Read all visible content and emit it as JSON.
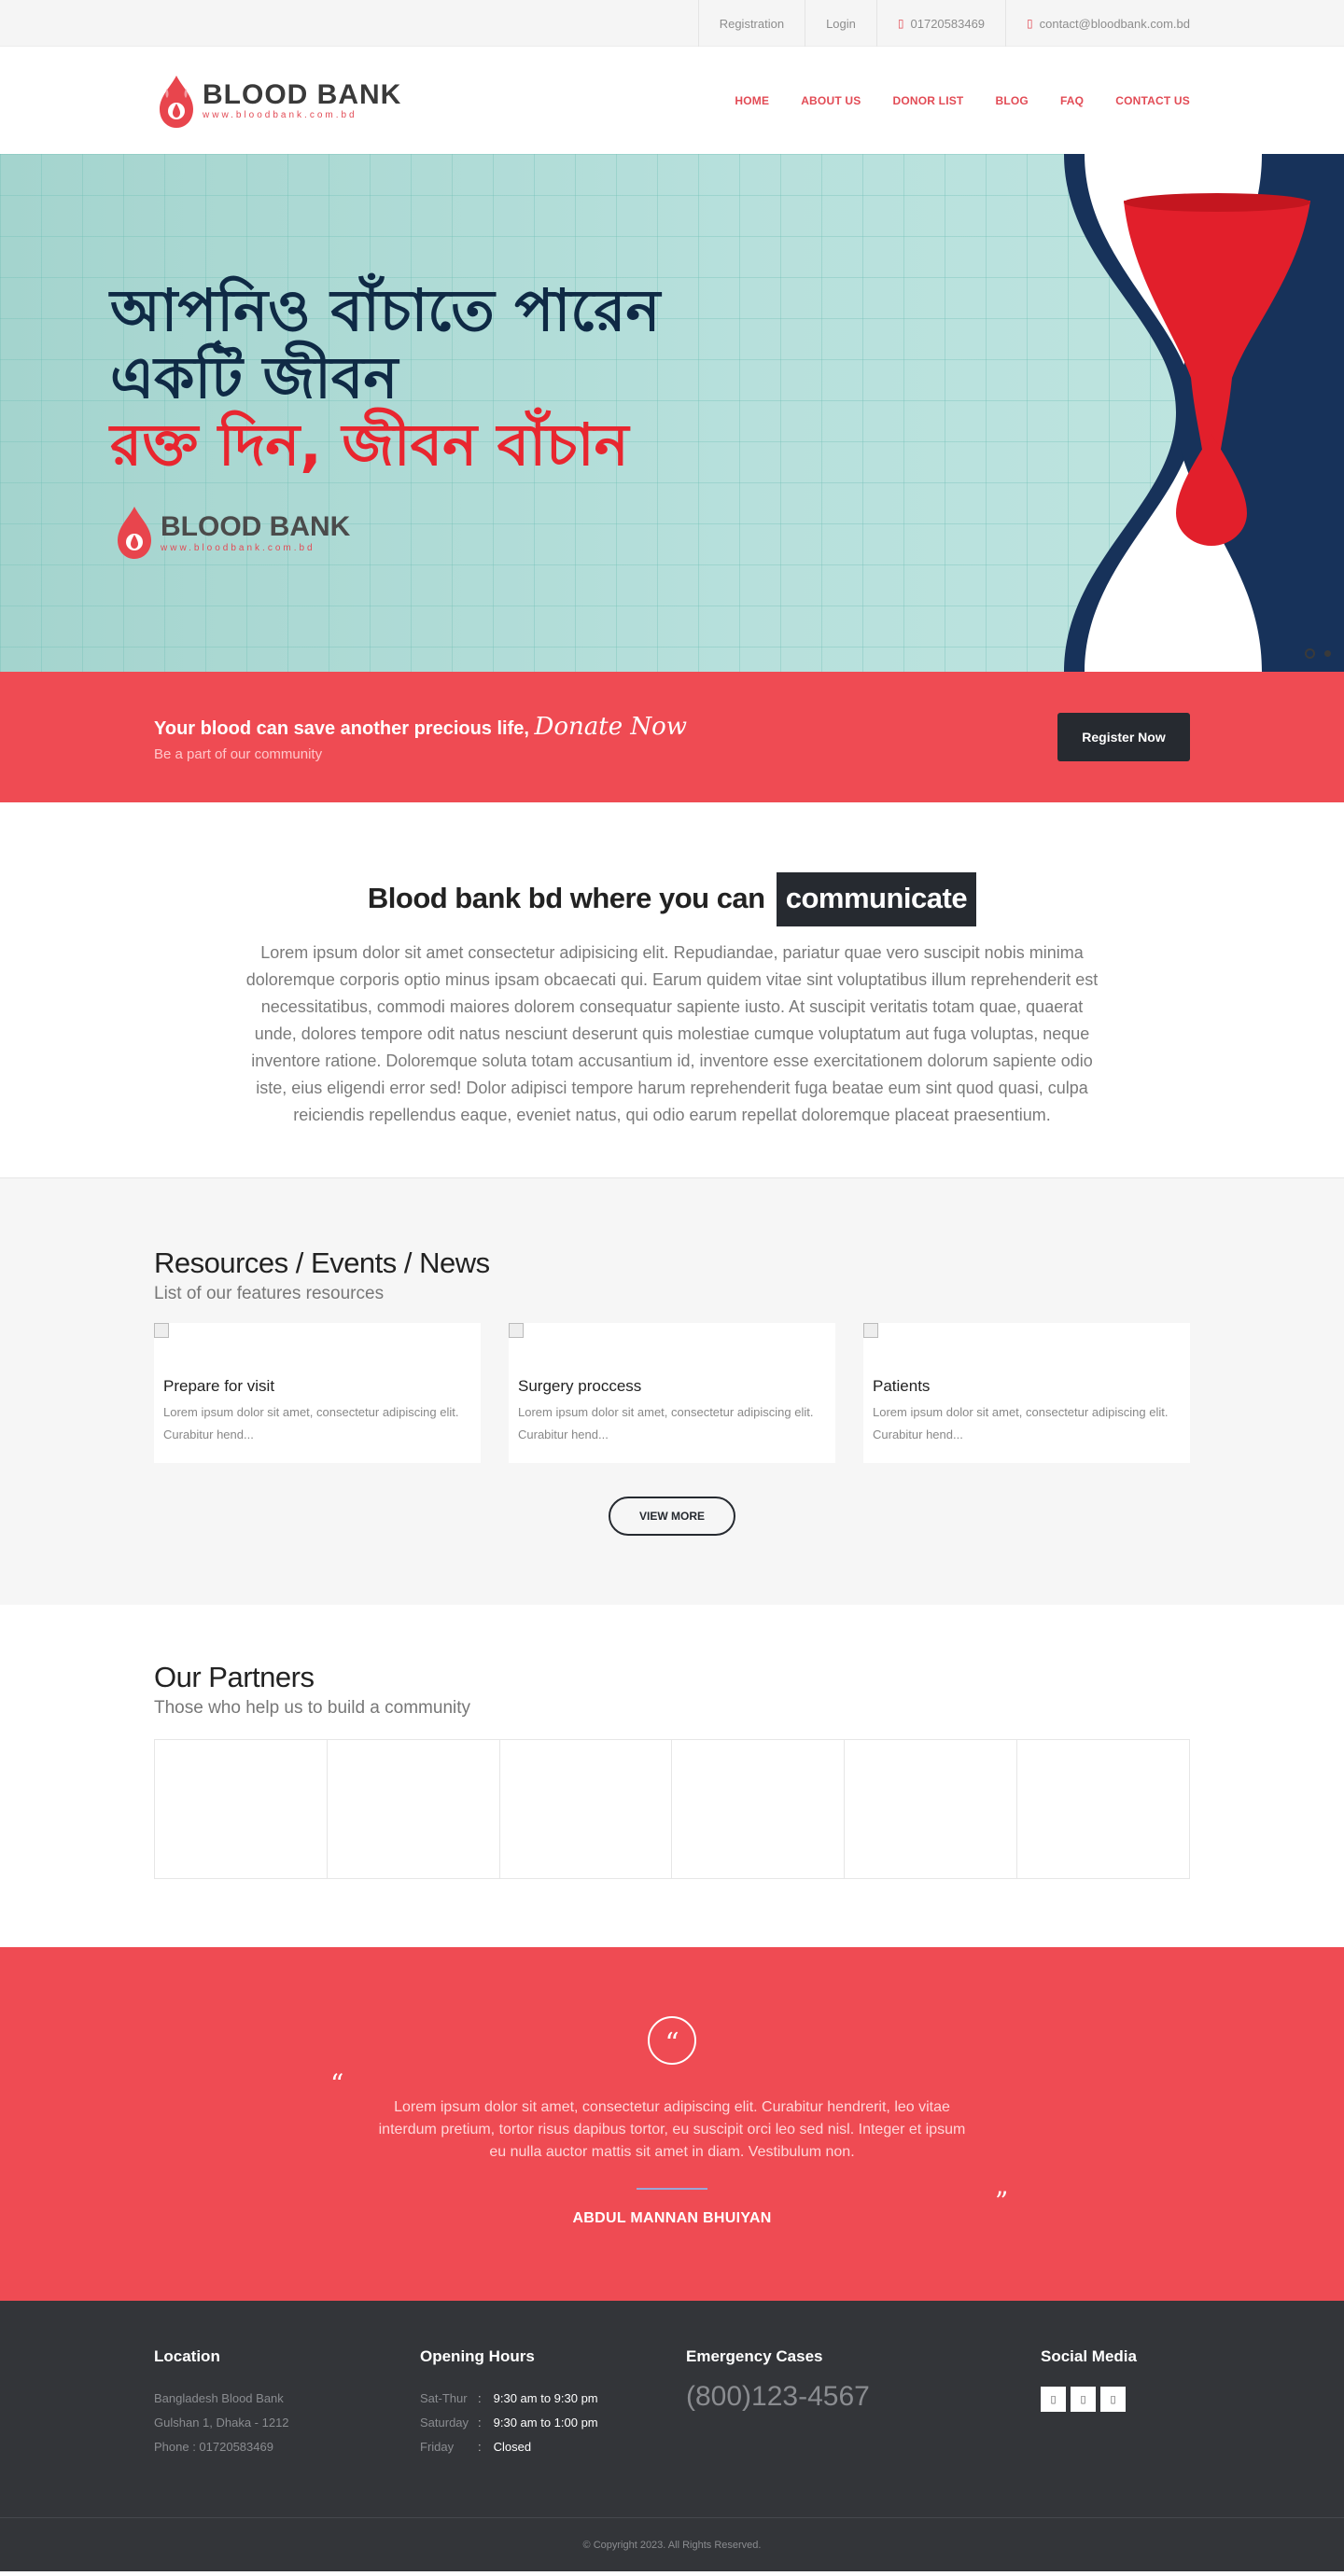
{
  "topbar": {
    "registration": "Registration",
    "login": "Login",
    "phone": "01720583469",
    "email": "contact@bloodbank.com.bd"
  },
  "header": {
    "logo_text": "BLOOD BANK",
    "logo_url": "www.bloodbank.com.bd",
    "nav": [
      "HOME",
      "ABOUT US",
      "DONOR LIST",
      "BLOG",
      "FAQ",
      "CONTACT US"
    ]
  },
  "hero": {
    "line1": "আপনিও বাঁচাতে পারেন",
    "line2": "একটি জীবন",
    "line3": "রক্ত দিন, জীবন বাঁচান",
    "logo_text": "BLOOD BANK",
    "logo_url": "www.bloodbank.com.bd"
  },
  "donate": {
    "text": "Your blood can save another precious life,",
    "script": "Donate Now",
    "sub": "Be a part of our community",
    "button": "Register Now"
  },
  "intro": {
    "title": "Blood bank bd where you can",
    "badge": "communicate",
    "body": "Lorem ipsum dolor sit amet consectetur adipisicing elit. Repudiandae, pariatur quae vero suscipit nobis minima doloremque corporis optio minus ipsam obcaecati qui. Earum quidem vitae sint voluptatibus illum reprehenderit est necessitatibus, commodi maiores dolorem consequatur sapiente iusto. At suscipit veritatis totam quae, quaerat unde, dolores tempore odit natus nesciunt deserunt quis molestiae cumque voluptatum aut fuga voluptas, neque inventore ratione. Doloremque soluta totam accusantium id, inventore esse exercitationem dolorum sapiente odio iste, eius eligendi error sed! Dolor adipisci tempore harum reprehenderit fuga beatae eum sint quod quasi, culpa reiciendis repellendus eaque, eveniet natus, qui odio earum repellat doloremque placeat praesentium."
  },
  "resources": {
    "title": "Resources / Events / News",
    "subtitle": "List of our features resources",
    "cards": [
      {
        "title": "Prepare for visit",
        "desc": "Lorem ipsum dolor sit amet, consectetur adipiscing elit. Curabitur hend..."
      },
      {
        "title": "Surgery proccess",
        "desc": "Lorem ipsum dolor sit amet, consectetur adipiscing elit. Curabitur hend..."
      },
      {
        "title": "Patients",
        "desc": "Lorem ipsum dolor sit amet, consectetur adipiscing elit. Curabitur hend..."
      }
    ],
    "view_more": "VIEW MORE"
  },
  "partners": {
    "title": "Our Partners",
    "subtitle": "Those who help us to build a community"
  },
  "testimonial": {
    "quote": "Lorem ipsum dolor sit amet, consectetur adipiscing elit. Curabitur hendrerit, leo vitae interdum pretium, tortor risus dapibus tortor, eu suscipit orci leo sed nisl. Integer et ipsum eu nulla auctor mattis sit amet in diam. Vestibulum non.",
    "author": "ABDUL MANNAN BHUIYAN"
  },
  "footer": {
    "location_title": "Location",
    "location_lines": [
      "Bangladesh Blood Bank",
      "Gulshan 1, Dhaka - 1212",
      "Phone : 01720583469"
    ],
    "hours_title": "Opening Hours",
    "hours": [
      {
        "day": "Sat-Thur",
        "time": "9:30 am to 9:30 pm"
      },
      {
        "day": "Saturday",
        "time": "9:30 am to 1:00 pm"
      },
      {
        "day": "Friday",
        "time": "Closed"
      }
    ],
    "emergency_title": "Emergency Cases",
    "emergency_phone": "(800)123-4567",
    "social_title": "Social Media",
    "copyright": "© Copyright 2023. All Rights Reserved."
  },
  "colors": {
    "brand_red": "#ef4b53",
    "dark": "#262a30",
    "footer": "#333539"
  }
}
